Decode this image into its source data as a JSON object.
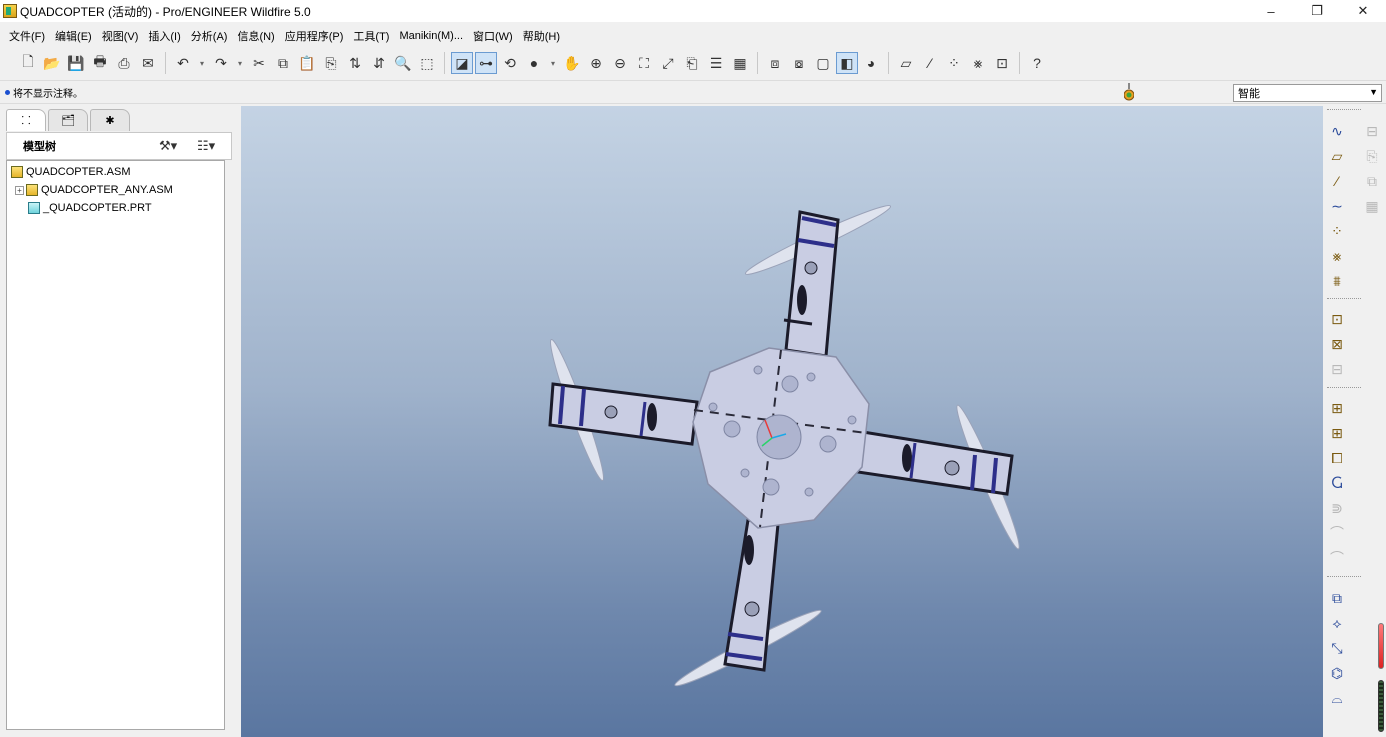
{
  "window": {
    "title": "QUADCOPTER (活动的) - Pro/ENGINEER Wildfire 5.0",
    "controls": [
      "–",
      "❐",
      "✕"
    ]
  },
  "menu": [
    "文件(F)",
    "编辑(E)",
    "视图(V)",
    "插入(I)",
    "分析(A)",
    "信息(N)",
    "应用程序(P)",
    "工具(T)",
    "Manikin(M)...",
    "窗口(W)",
    "帮助(H)"
  ],
  "status": {
    "message": "将不显示注释。",
    "filter_value": "智能"
  },
  "model_tree": {
    "title": "模型树",
    "tabs": [
      "model-tree-tab",
      "layer-tab",
      "favorites-tab"
    ],
    "items": [
      {
        "label": "QUADCOPTER.ASM",
        "type": "asm",
        "level": 0
      },
      {
        "label": "QUADCOPTER_ANY.ASM",
        "type": "asm",
        "level": 1,
        "expandable": true
      },
      {
        "label": "_QUADCOPTER.PRT",
        "type": "prt",
        "level": 1
      }
    ]
  },
  "colors": {
    "viewport_top": "#c4d3e4",
    "viewport_bottom": "#5a76a0",
    "model_plate": "#c9cde3",
    "frame_dark": "#1b1b2a",
    "strut_blue": "#2d2f8a",
    "propeller": "#dfe3ee",
    "toolbar_active": "#cfe3f7"
  }
}
